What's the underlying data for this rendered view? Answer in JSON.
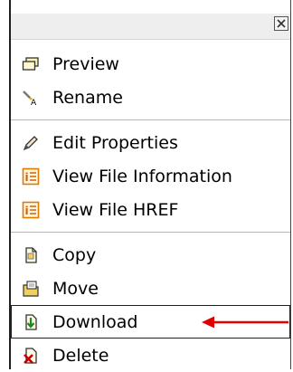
{
  "menu": {
    "items": [
      {
        "label": "Preview",
        "icon": "preview-icon"
      },
      {
        "label": "Rename",
        "icon": "rename-icon"
      },
      {
        "label": "Edit Properties",
        "icon": "pencil-icon"
      },
      {
        "label": "View File Information",
        "icon": "info-icon"
      },
      {
        "label": "View File HREF",
        "icon": "info-icon"
      },
      {
        "label": "Copy",
        "icon": "copy-icon"
      },
      {
        "label": "Move",
        "icon": "move-icon"
      },
      {
        "label": "Download",
        "icon": "download-icon"
      },
      {
        "label": "Delete",
        "icon": "delete-icon"
      }
    ]
  },
  "colors": {
    "arrow": "#e00000",
    "info_icon": "#e07a00",
    "download_arrow": "#1a8a1a",
    "delete_x": "#c00000"
  }
}
